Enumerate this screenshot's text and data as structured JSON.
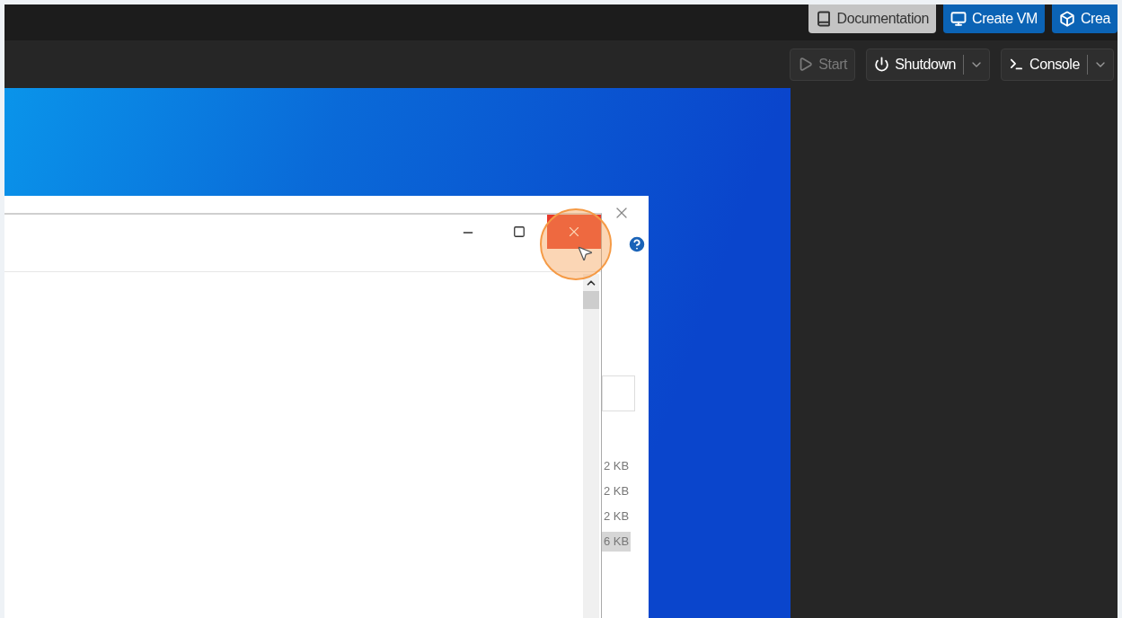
{
  "top_bar": {
    "buttons": [
      {
        "label": "Documentation",
        "kind": "secondary"
      },
      {
        "label": "Create VM",
        "kind": "primary"
      },
      {
        "label": "Crea",
        "kind": "primary"
      }
    ]
  },
  "toolbar": {
    "buttons": [
      {
        "label": "Start",
        "disabled": true,
        "split": false
      },
      {
        "label": "Shutdown",
        "disabled": false,
        "split": true
      },
      {
        "label": "Console",
        "disabled": false,
        "split": true
      }
    ]
  },
  "back_window": {
    "file_sizes": [
      {
        "text": "2 KB",
        "selected": false
      },
      {
        "text": "2 KB",
        "selected": false
      },
      {
        "text": "2 KB",
        "selected": false
      },
      {
        "text": "6 KB",
        "selected": true
      }
    ]
  },
  "front_window": {
    "close_highlighted": true
  }
}
